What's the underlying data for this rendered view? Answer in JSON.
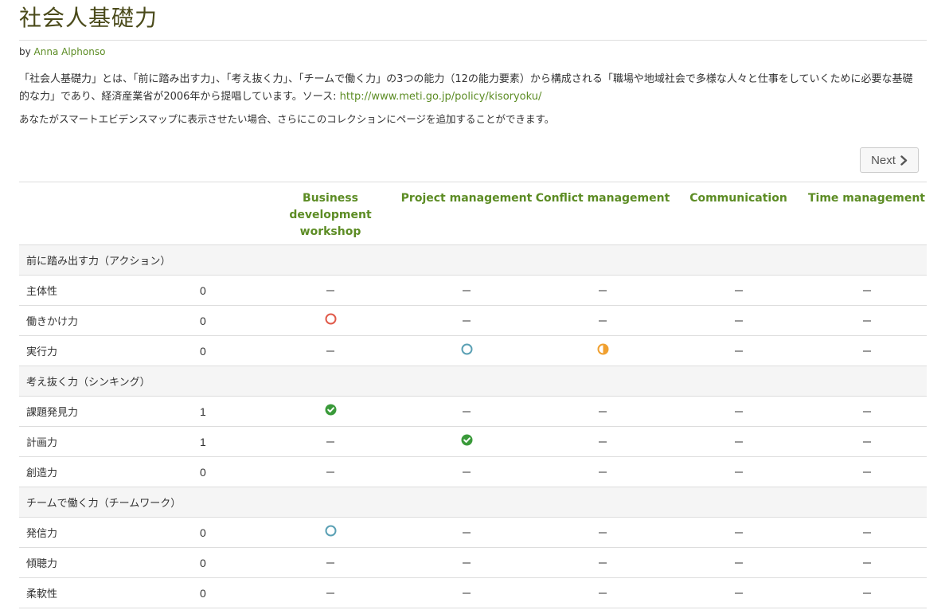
{
  "page": {
    "title": "社会人基礎力",
    "by_prefix": "by",
    "author": "Anna Alphonso",
    "description": "「社会人基礎力」とは、「前に踏み出す力」、「考え抜く力」、「チームで働く力」の3つの能力（12の能力要素）から構成される「職場や地域社会で多様な人々と仕事をしていくために必要な基礎的な力」であり、経済産業省が2006年から提唱しています。ソース: ",
    "source_link": "http://www.meti.go.jp/policy/kisoryoku/",
    "note": "あなたがスマートエビデンスマップに表示させたい場合、さらにこのコレクションにページを追加することができます。"
  },
  "next_button": {
    "label": "Next",
    "icon": "chevron-right-icon"
  },
  "colors": {
    "accent_green": "#5c8c24",
    "red_circle": "#e05a4a",
    "blue_circle": "#5aa0b4",
    "orange_half": "#f0a030",
    "green_check": "#3a9a3a"
  },
  "columns": [
    "Business development workshop",
    "Project management",
    "Conflict management",
    "Communication",
    "Time management"
  ],
  "groups": [
    {
      "name": "前に踏み出す力（アクション）",
      "rows": [
        {
          "label": "主体性",
          "count": "0",
          "cells": [
            "none",
            "none",
            "none",
            "none",
            "none"
          ]
        },
        {
          "label": "働きかけ力",
          "count": "0",
          "cells": [
            "circle-red",
            "none",
            "none",
            "none",
            "none"
          ]
        },
        {
          "label": "実行力",
          "count": "0",
          "cells": [
            "none",
            "circle-blue",
            "half-orange",
            "none",
            "none"
          ]
        }
      ]
    },
    {
      "name": "考え抜く力（シンキング）",
      "rows": [
        {
          "label": "課題発見力",
          "count": "1",
          "cells": [
            "check-green",
            "none",
            "none",
            "none",
            "none"
          ]
        },
        {
          "label": "計画力",
          "count": "1",
          "cells": [
            "none",
            "check-green",
            "none",
            "none",
            "none"
          ]
        },
        {
          "label": "創造力",
          "count": "0",
          "cells": [
            "none",
            "none",
            "none",
            "none",
            "none"
          ]
        }
      ]
    },
    {
      "name": "チームで働く力（チームワーク）",
      "rows": [
        {
          "label": "発信力",
          "count": "0",
          "cells": [
            "circle-blue",
            "none",
            "none",
            "none",
            "none"
          ]
        },
        {
          "label": "傾聴力",
          "count": "0",
          "cells": [
            "none",
            "none",
            "none",
            "none",
            "none"
          ]
        },
        {
          "label": "柔軟性",
          "count": "0",
          "cells": [
            "none",
            "none",
            "none",
            "none",
            "none"
          ]
        }
      ]
    }
  ]
}
